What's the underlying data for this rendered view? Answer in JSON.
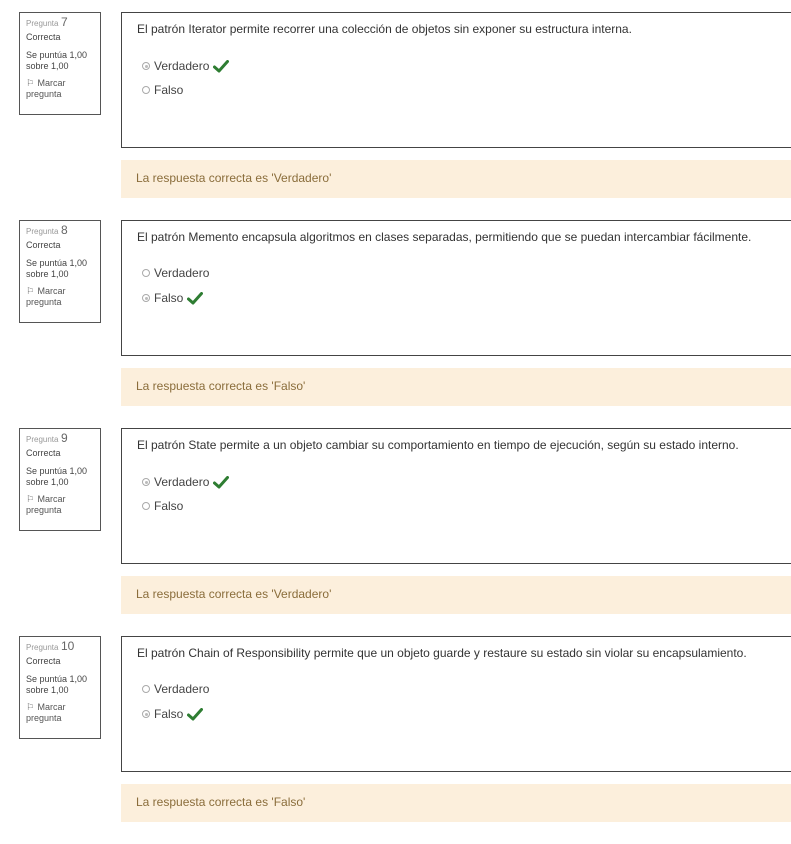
{
  "questions": [
    {
      "word": "Pregunta",
      "number": "7",
      "state": "Correcta",
      "grade": "Se puntúa 1,00 sobre 1,00",
      "flag": "Marcar pregunta",
      "text": "El patrón Iterator permite recorrer una colección de objetos sin exponer su estructura interna.",
      "options": [
        {
          "label": "Verdadero",
          "selected": true,
          "correct": true
        },
        {
          "label": "Falso",
          "selected": false,
          "correct": false
        }
      ],
      "feedback": "La respuesta correcta es 'Verdadero'"
    },
    {
      "word": "Pregunta",
      "number": "8",
      "state": "Correcta",
      "grade": "Se puntúa 1,00 sobre 1,00",
      "flag": "Marcar pregunta",
      "text": "El patrón Memento encapsula algoritmos en clases separadas, permitiendo que se puedan intercambiar fácilmente.",
      "options": [
        {
          "label": "Verdadero",
          "selected": false,
          "correct": false
        },
        {
          "label": "Falso",
          "selected": true,
          "correct": true
        }
      ],
      "feedback": "La respuesta correcta es 'Falso'"
    },
    {
      "word": "Pregunta",
      "number": "9",
      "state": "Correcta",
      "grade": "Se puntúa 1,00 sobre 1,00",
      "flag": "Marcar pregunta",
      "text": "El patrón State permite a un objeto cambiar su comportamiento en tiempo de ejecución, según su estado interno.",
      "options": [
        {
          "label": "Verdadero",
          "selected": true,
          "correct": true
        },
        {
          "label": "Falso",
          "selected": false,
          "correct": false
        }
      ],
      "feedback": "La respuesta correcta es 'Verdadero'"
    },
    {
      "word": "Pregunta",
      "number": "10",
      "state": "Correcta",
      "grade": "Se puntúa 1,00 sobre 1,00",
      "flag": "Marcar pregunta",
      "text": "El patrón Chain of Responsibility permite que un objeto guarde y restaure su estado sin violar su encapsulamiento.",
      "options": [
        {
          "label": "Verdadero",
          "selected": false,
          "correct": false
        },
        {
          "label": "Falso",
          "selected": true,
          "correct": true
        }
      ],
      "feedback": "La respuesta correcta es 'Falso'"
    }
  ],
  "colors": {
    "feedback_bg": "#fcefdc",
    "feedback_text": "#8a6d3b",
    "check": "#2e7d32"
  },
  "icons": {
    "correct": "check-icon",
    "flag": "flag-icon"
  }
}
